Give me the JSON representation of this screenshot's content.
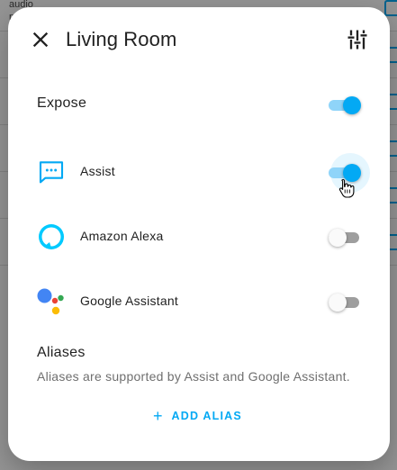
{
  "background": {
    "row_text_1": "audio",
    "row_text_2": "m"
  },
  "dialog": {
    "title": "Living Room",
    "expose": {
      "label": "Expose",
      "enabled": true
    },
    "assistants": [
      {
        "label": "Assist",
        "icon": "assist-chat-icon",
        "enabled": true
      },
      {
        "label": "Amazon Alexa",
        "icon": "alexa-ring-icon",
        "enabled": false
      },
      {
        "label": "Google Assistant",
        "icon": "google-assistant-dots-icon",
        "enabled": false
      }
    ],
    "aliases": {
      "title": "Aliases",
      "description": "Aliases are supported by Assist and Google Assistant.",
      "add_label": "ADD ALIAS"
    }
  },
  "colors": {
    "accent": "#03a9f4",
    "switch_on_track": "#8fd4f9",
    "switch_off_track": "#9e9e9e",
    "alexa": "#00caff"
  }
}
